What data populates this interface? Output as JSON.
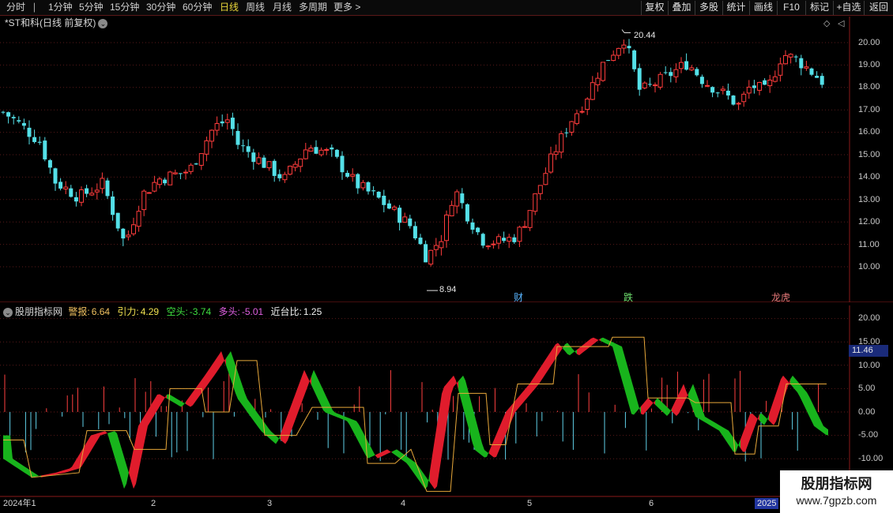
{
  "toolbar": {
    "periods": [
      "分时",
      "1分钟",
      "5分钟",
      "15分钟",
      "30分钟",
      "60分钟",
      "日线",
      "周线",
      "月线",
      "多周期",
      "更多 >"
    ],
    "active_period": "日线",
    "buttons": [
      "复权",
      "叠加",
      "多股",
      "统计",
      "画线",
      "F10",
      "标记",
      "+自选",
      "返回"
    ]
  },
  "main_chart": {
    "title": "*ST和科(日线 前复权)",
    "price_axis": [
      "20.00",
      "19.00",
      "18.00",
      "17.00",
      "16.00",
      "15.00",
      "14.00",
      "13.00",
      "12.00",
      "11.00",
      "10.00"
    ],
    "high_label": "20.44",
    "low_label": "8.94",
    "events": [
      {
        "text": "财",
        "color": "#58b4ff"
      },
      {
        "text": "跌",
        "color": "#6fe06f"
      },
      {
        "text": "龙虎",
        "color": "#e87a7a"
      }
    ],
    "colors": {
      "up": "#ff3c3c",
      "down": "#54e0e8",
      "grid": "#5a1a1a"
    }
  },
  "indicator": {
    "name": "股朋指标网",
    "values": [
      {
        "label": "警报:",
        "value": "6.64",
        "color": "#f0c060"
      },
      {
        "label": "引力:",
        "value": "4.29",
        "color": "#f0e050"
      },
      {
        "label": "空头:",
        "value": "-3.74",
        "color": "#40e040"
      },
      {
        "label": "多头:",
        "value": "-5.01",
        "color": "#e060e0"
      },
      {
        "label": "近台比:",
        "value": "1.25",
        "color": "#f0f0f0"
      }
    ],
    "axis": [
      "20.00",
      "15.00",
      "10.00",
      "5.00",
      "0.00",
      "-5.00",
      "-10.00"
    ],
    "current_badge": "11.46"
  },
  "x_axis": {
    "labels": [
      "2024年1",
      "2",
      "3",
      "4",
      "5",
      "6"
    ],
    "year_badge": "2025"
  },
  "watermark": {
    "line1": "股朋指标网",
    "line2": "www.7gpzb.com"
  }
}
